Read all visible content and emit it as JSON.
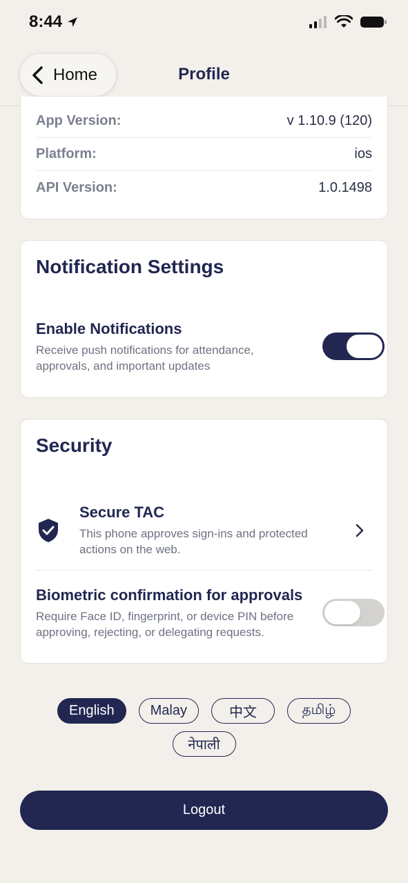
{
  "status_bar": {
    "time": "8:44"
  },
  "nav": {
    "back_label": "Home",
    "title": "Profile"
  },
  "app_info": {
    "rows": [
      {
        "key": "App Version:",
        "value": "v 1.10.9 (120)"
      },
      {
        "key": "Platform:",
        "value": "ios"
      },
      {
        "key": "API Version:",
        "value": "1.0.1498"
      }
    ]
  },
  "notification_settings": {
    "title": "Notification Settings",
    "enable": {
      "title": "Enable Notifications",
      "description": "Receive push notifications for attendance, approvals, and important updates",
      "enabled": true
    }
  },
  "security": {
    "title": "Security",
    "secure_tac": {
      "title": "Secure TAC",
      "description": "This phone approves sign-ins and protected actions on the web."
    },
    "biometric": {
      "title": "Biometric confirmation for approvals",
      "description": "Require Face ID, fingerprint, or device PIN before approving, rejecting, or delegating requests.",
      "enabled": false
    }
  },
  "languages": {
    "options": [
      "English",
      "Malay",
      "中文",
      "தமிழ்",
      "नेपाली"
    ],
    "selected": "English"
  },
  "logout_label": "Logout",
  "colors": {
    "primary": "#222751",
    "background": "#f3f0eb",
    "card": "#ffffff"
  }
}
